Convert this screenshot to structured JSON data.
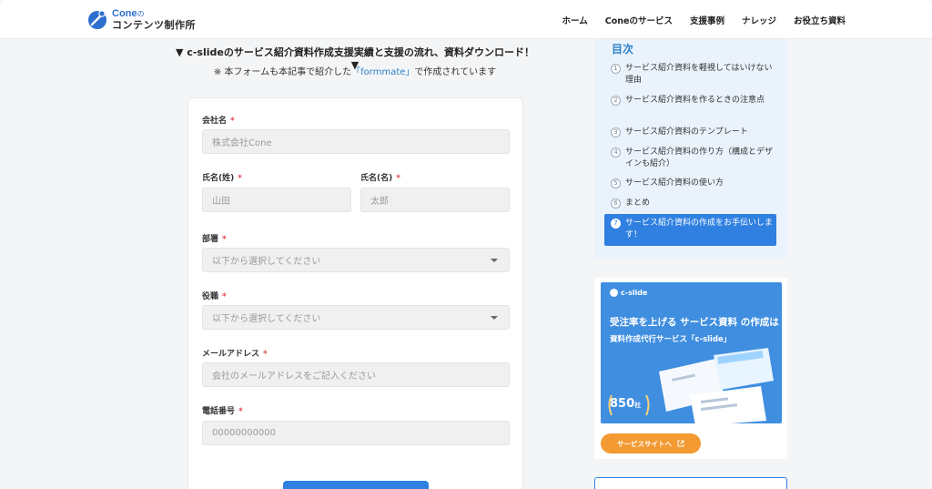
{
  "header": {
    "logo_line1": "Cone",
    "logo_no": "の",
    "logo_line2": "コンテンツ制作所",
    "nav": [
      "ホーム",
      "Coneのサービス",
      "支援事例",
      "ナレッジ",
      "お役立ち資料"
    ]
  },
  "intro": {
    "heading": "▼ c-slideのサービス紹介資料作成支援実績と支援の流れ、資料ダウンロード！▼",
    "note_prefix": "※ 本フォームも本記事で紹介した",
    "note_link": "「formmate」",
    "note_suffix": "で作成されています"
  },
  "form": {
    "required_mark": "*",
    "company": {
      "label": "会社名",
      "placeholder": "株式会社Cone"
    },
    "last_name": {
      "label": "氏名(姓)",
      "placeholder": "山田"
    },
    "first_name": {
      "label": "氏名(名)",
      "placeholder": "太郎"
    },
    "department": {
      "label": "部署",
      "placeholder": "以下から選択してください"
    },
    "position": {
      "label": "役職",
      "placeholder": "以下から選択してください"
    },
    "email": {
      "label": "メールアドレス",
      "placeholder": "会社のメールアドレスをご記入ください"
    },
    "phone": {
      "label": "電話番号",
      "placeholder": "00000000000"
    }
  },
  "toc": {
    "title": "目次",
    "items": [
      {
        "num": "1",
        "text": "サービス紹介資料を軽視してはいけない理由"
      },
      {
        "num": "2",
        "text": "サービス紹介資料を作るときの注意点"
      },
      {
        "num": "3",
        "text": "サービス紹介資料のテンプレート"
      },
      {
        "num": "4",
        "text": "サービス紹介資料の作り方（構成とデザインも紹介）"
      },
      {
        "num": "5",
        "text": "サービス紹介資料の使い方"
      },
      {
        "num": "6",
        "text": "まとめ"
      },
      {
        "num": "7",
        "text": "サービス紹介資料の作成をお手伝いします！"
      }
    ]
  },
  "banner": {
    "logo": "c-slide",
    "title": "受注率を上げる サービス資料 の作成は",
    "subtitle": "資料作成代行サービス「c-slide」",
    "award_value": "850",
    "award_unit": "社",
    "button": "サービスサイトへ"
  },
  "colors": {
    "accent": "#2f80e0",
    "toc_bg": "#eaf3fc",
    "orange": "#f39a32",
    "required": "#e2434b"
  }
}
